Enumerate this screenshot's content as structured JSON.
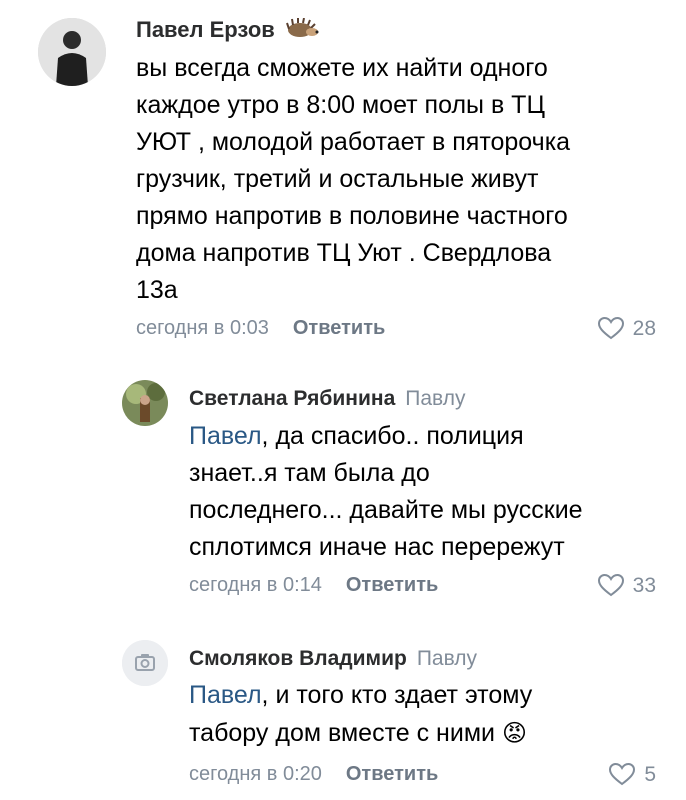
{
  "comments": [
    {
      "author": "Павел Ерзов",
      "badge": "hedgehog-icon",
      "text": "вы всегда сможете их найти одного\nкаждое утро в 8:00 моет полы в ТЦ\nУЮТ , молодой работает в пяторочка\nгрузчик, третий и остальные живут\nпрямо напротив в половине частного\nдома напротив ТЦ Уют . Свердлова\n13а",
      "time": "сегодня в 0:03",
      "reply_label": "Ответить",
      "likes": "28"
    },
    {
      "author": "Светлана Рябинина",
      "reply_to": "Павлу",
      "mention": "Павел",
      "text": ", да спасибо.. полиция\nзнает..я там была до\nпоследнего... давайте мы русские\nсплотимся  иначе нас перережут",
      "time": "сегодня в 0:14",
      "reply_label": "Ответить",
      "likes": "33"
    },
    {
      "author": "Смоляков Владимир",
      "reply_to": "Павлу",
      "mention": "Павел",
      "text": ", и  того кто здает этому\nтабору дом вместе с ними",
      "emoji": "😡",
      "time": "сегодня в 0:20",
      "reply_label": "Ответить",
      "likes": "5"
    }
  ],
  "colors": {
    "name": "#2c2d2e",
    "secondary": "#818c99",
    "mention": "#2a5885",
    "action": "#6d7885"
  }
}
